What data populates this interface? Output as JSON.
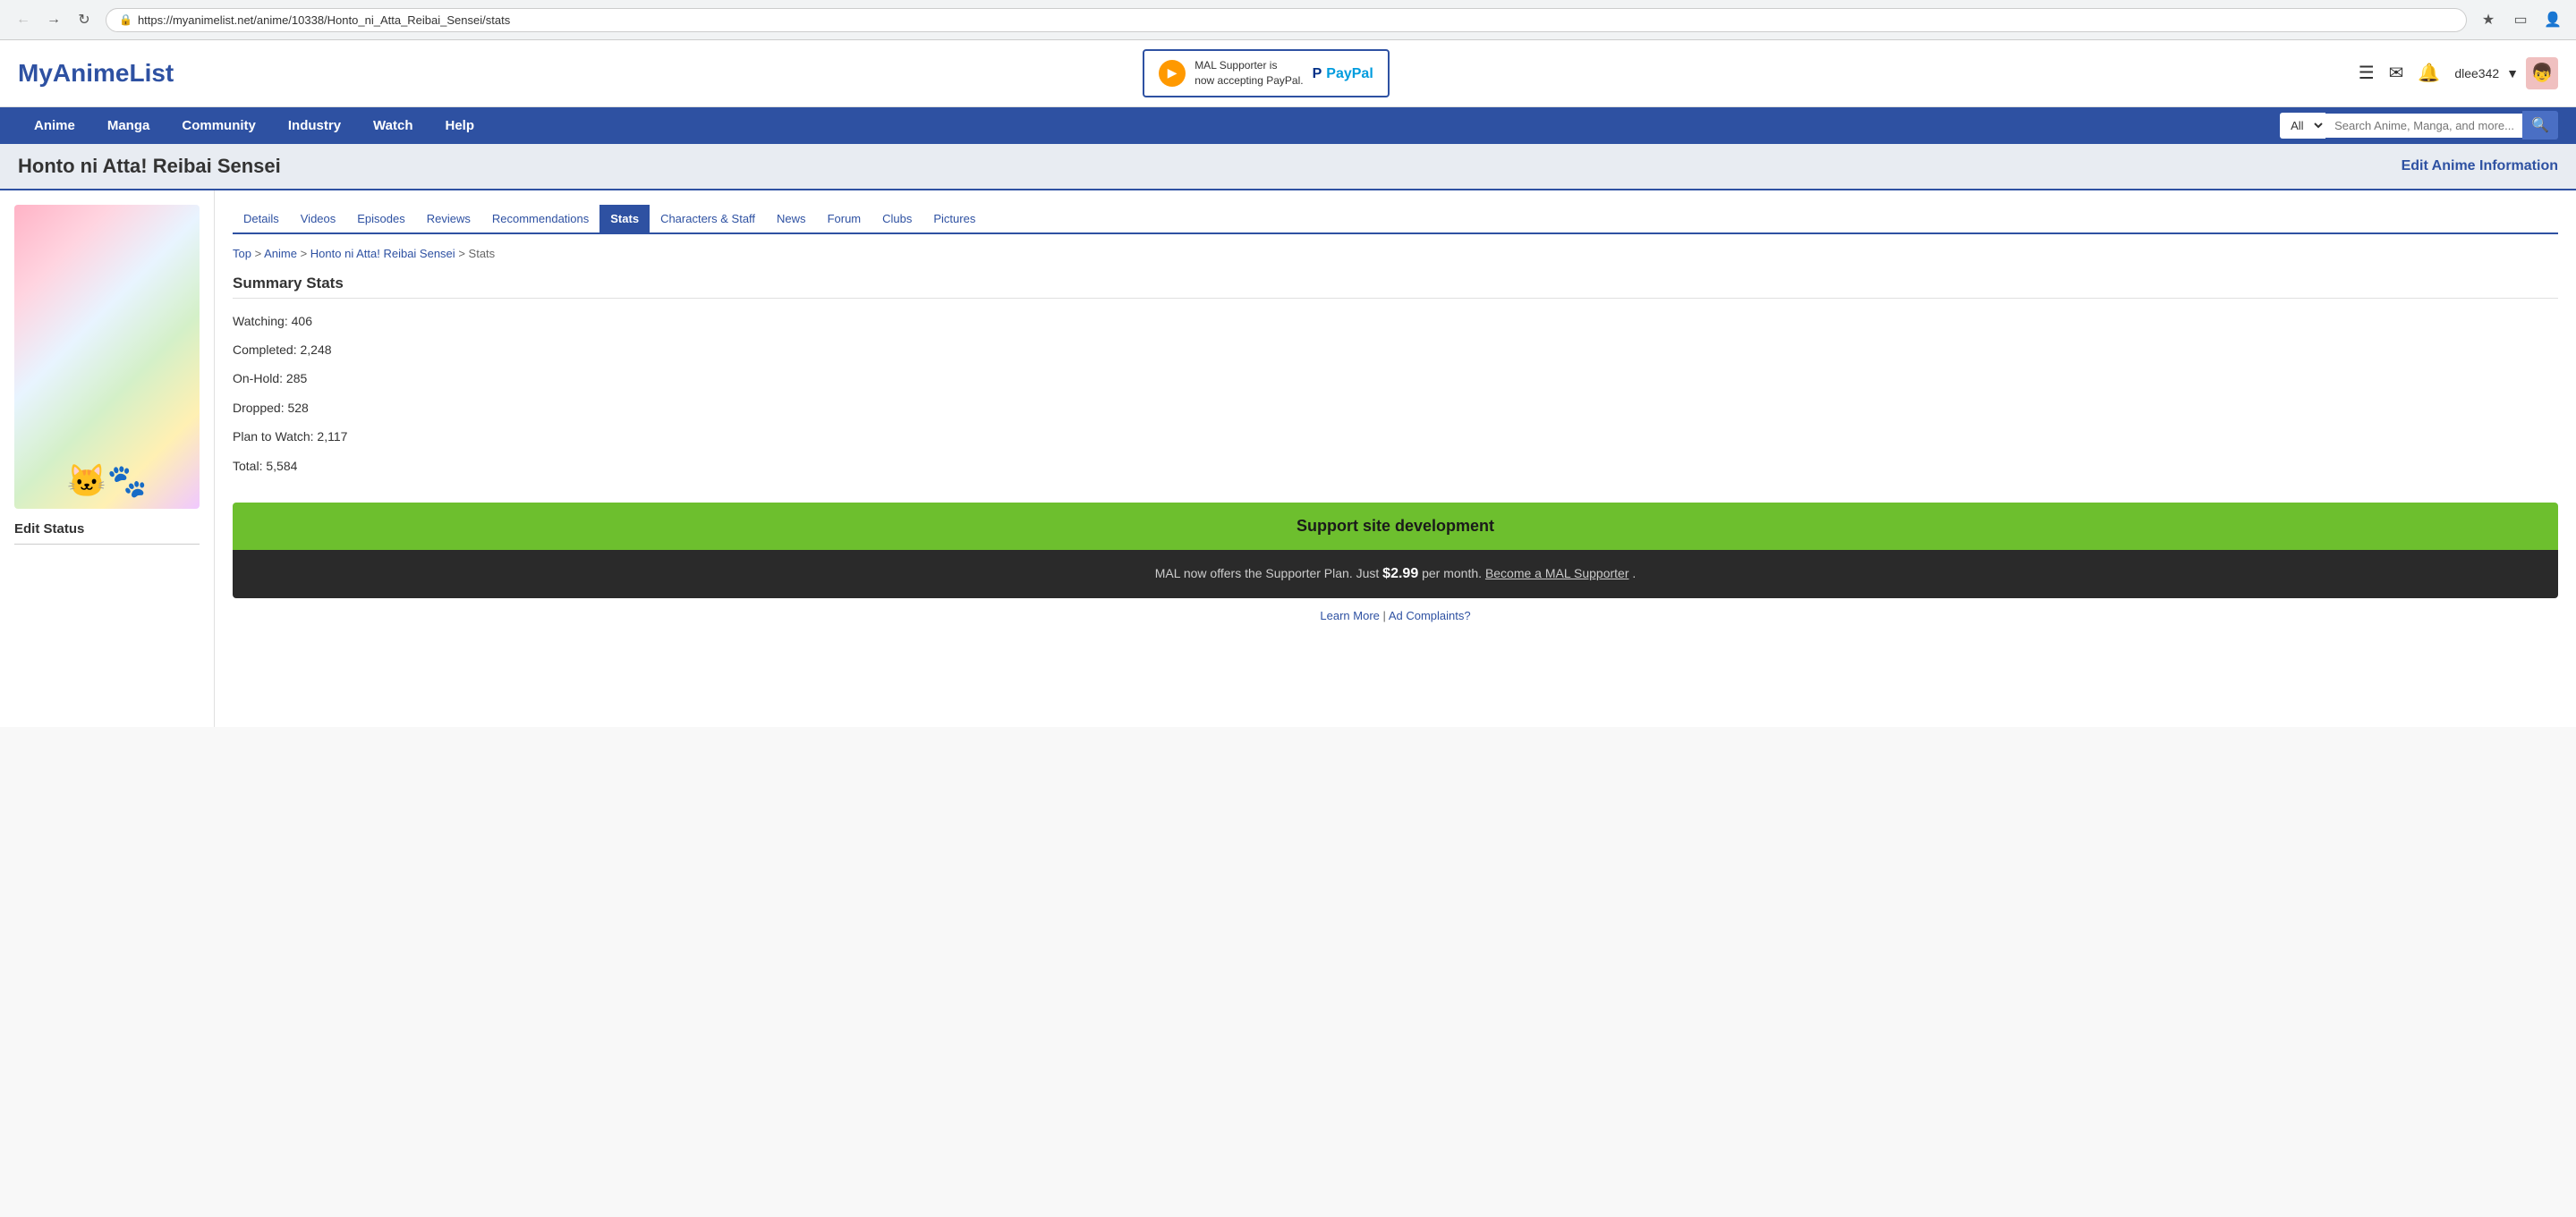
{
  "browser": {
    "url": "https://myanimelist.net/anime/10338/Honto_ni_Atta_Reibai_Sensei/stats",
    "secure_label": "Secure"
  },
  "header": {
    "logo": "MyAnimeList",
    "paypal_banner": {
      "text_line1": "MAL Supporter is",
      "text_line2": "now accepting PayPal.",
      "paypal_label": "PayPal"
    },
    "user": {
      "name": "dlee342"
    }
  },
  "nav": {
    "items": [
      "Anime",
      "Manga",
      "Community",
      "Industry",
      "Watch",
      "Help"
    ],
    "search_placeholder": "Search Anime, Manga, and more...",
    "search_option": "All"
  },
  "page_title": "Honto ni Atta! Reibai Sensei",
  "edit_link": "Edit Anime Information",
  "sub_nav": {
    "items": [
      "Details",
      "Videos",
      "Episodes",
      "Reviews",
      "Recommendations",
      "Stats",
      "Characters & Staff",
      "News",
      "Forum",
      "Clubs",
      "Pictures"
    ],
    "active": "Stats"
  },
  "breadcrumb": {
    "items": [
      "Top",
      "Anime",
      "Honto ni Atta! Reibai Sensei",
      "Stats"
    ]
  },
  "stats": {
    "title": "Summary Stats",
    "watching_label": "Watching:",
    "watching_value": "406",
    "completed_label": "Completed:",
    "completed_value": "2,248",
    "onhold_label": "On-Hold:",
    "onhold_value": "285",
    "dropped_label": "Dropped:",
    "dropped_value": "528",
    "plantowatch_label": "Plan to Watch:",
    "plantowatch_value": "2,117",
    "total_label": "Total:",
    "total_value": "5,584"
  },
  "edit_status": {
    "label": "Edit Status"
  },
  "support": {
    "header": "Support site development",
    "body_text": "MAL now offers the Supporter Plan. Just",
    "price": "$2.99",
    "per_month": "per month.",
    "become_link": "Become a MAL Supporter",
    "period": "."
  },
  "footer": {
    "learn_more": "Learn More",
    "separator": "|",
    "ad_complaints": "Ad Complaints?"
  }
}
